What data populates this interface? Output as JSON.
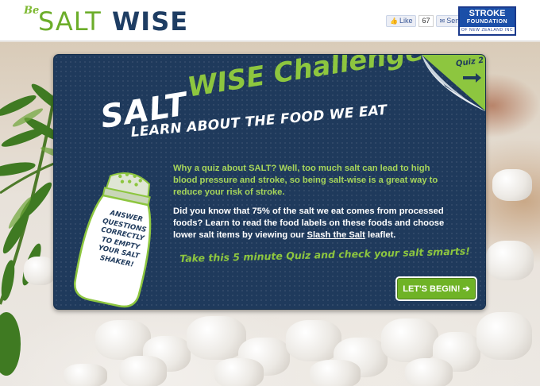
{
  "header": {
    "logo": {
      "be": "Be",
      "salt": "SALT",
      "wise": "WISE"
    },
    "social": {
      "like_label": "Like",
      "like_count": "67",
      "send_label": "Send"
    },
    "partner_logo": {
      "line1": "STROKE",
      "line2": "FOUNDATION",
      "line3": "OF NEW ZEALAND INC"
    }
  },
  "quiz": {
    "tag": "Quiz 2",
    "title_salt": "SALT",
    "title_challenge": "WISE Challenge",
    "subtitle": "LEARN ABOUT THE FOOD WE EAT",
    "intro": "Why a quiz about SALT? Well, too much salt can lead to high blood pressure and stroke, so being salt-wise is a great way to reduce your risk of stroke.",
    "body_before_link": "Did you know that 75% of the salt we eat comes from processed foods? Learn to read the food labels on these foods and choose lower salt items by viewing our ",
    "link_text": "Slash the Salt",
    "body_after_link": " leaflet.",
    "cta_text": "Take this 5 minute Quiz and check your salt smarts!",
    "begin_button": "LET'S BEGIN! ➔",
    "shaker_label": [
      "ANSWER",
      "QUESTIONS",
      "CORRECTLY",
      "TO EMPTY",
      "YOUR SALT",
      "SHAKER!"
    ]
  },
  "colors": {
    "panel_bg": "#1f3a5c",
    "accent_green": "#8dc63f",
    "button_green": "#6fb326",
    "logo_navy": "#1e3d63"
  }
}
